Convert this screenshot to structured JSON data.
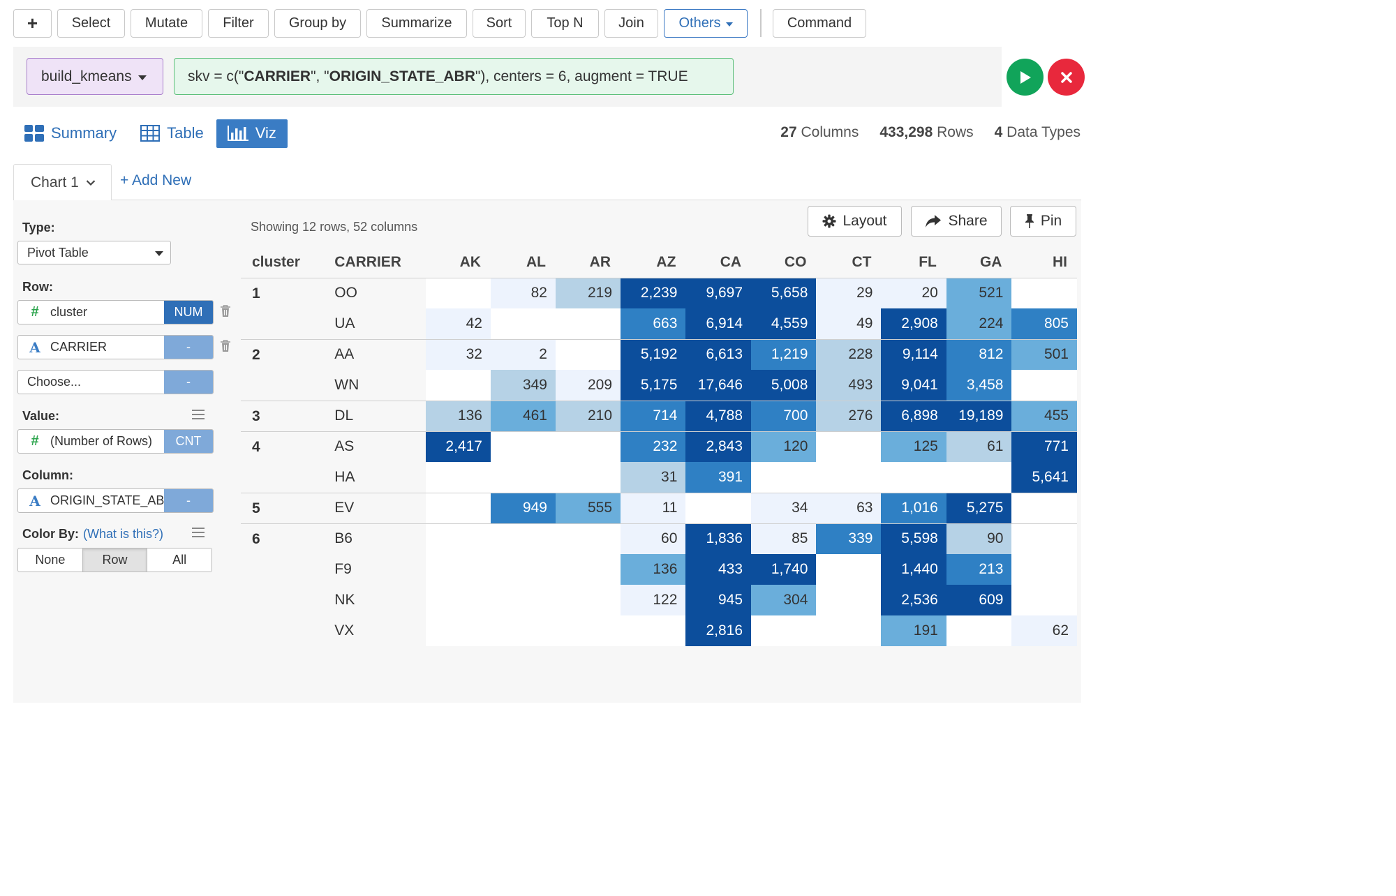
{
  "toolbar": {
    "plus_label": "+",
    "buttons": [
      "Select",
      "Mutate",
      "Filter",
      "Group by",
      "Summarize",
      "Sort",
      "Top N",
      "Join"
    ],
    "others_label": "Others",
    "command_label": "Command"
  },
  "command": {
    "function_name": "build_kmeans",
    "args_prefix": "skv = c(\"",
    "arg1": "CARRIER",
    "args_mid": "\", \"",
    "arg2": "ORIGIN_STATE_ABR",
    "args_suffix": "\"), centers = 6, augment = TRUE"
  },
  "view_tabs": {
    "summary": "Summary",
    "table": "Table",
    "viz": "Viz"
  },
  "stats": {
    "columns_count": "27",
    "columns_label": "Columns",
    "rows_count": "433,298",
    "rows_label": "Rows",
    "types_count": "4",
    "types_label": "Data Types"
  },
  "chart_tabs": {
    "current": "Chart 1",
    "add_new": "+ Add New"
  },
  "config": {
    "type_label": "Type:",
    "type_value": "Pivot Table",
    "row_label": "Row:",
    "row_fields": [
      {
        "name": "cluster",
        "type": "NUM"
      },
      {
        "name": "CARRIER",
        "type": "-"
      },
      {
        "name": "Choose...",
        "type": "-"
      }
    ],
    "value_label": "Value:",
    "value_field": {
      "name": "(Number of Rows)",
      "type": "CNT"
    },
    "column_label": "Column:",
    "column_field": {
      "name": "ORIGIN_STATE_ABR",
      "type": "-"
    },
    "color_by_label": "Color By:",
    "what_is_this": "(What is this?)",
    "color_by_options": [
      "None",
      "Row",
      "All"
    ],
    "color_by_selected": "Row"
  },
  "chart_toolbar": {
    "showing": "Showing 12 rows, 52 columns",
    "layout": "Layout",
    "share": "Share",
    "pin": "Pin"
  },
  "colors": {
    "level0": "#ffffff",
    "level1": "#edf3fd",
    "level2": "#b6d2e6",
    "level3": "#6aaedb",
    "level4": "#2f80c4",
    "level5": "#0c4e9c"
  },
  "chart_data": {
    "type": "table",
    "row_headers": [
      "cluster",
      "CARRIER"
    ],
    "columns": [
      "AK",
      "AL",
      "AR",
      "AZ",
      "CA",
      "CO",
      "CT",
      "FL",
      "GA",
      "HI"
    ],
    "rows": [
      {
        "cluster": "1",
        "carrier": "OO",
        "values": [
          "",
          "82",
          "219",
          "2,239",
          "9,697",
          "5,658",
          "29",
          "20",
          "521",
          ""
        ],
        "levels": [
          0,
          1,
          2,
          5,
          5,
          5,
          1,
          1,
          3,
          0
        ]
      },
      {
        "cluster": "",
        "carrier": "UA",
        "values": [
          "42",
          "",
          "",
          "663",
          "6,914",
          "4,559",
          "49",
          "2,908",
          "224",
          "805"
        ],
        "levels": [
          1,
          0,
          0,
          4,
          5,
          5,
          1,
          5,
          3,
          4
        ]
      },
      {
        "cluster": "2",
        "carrier": "AA",
        "values": [
          "32",
          "2",
          "",
          "5,192",
          "6,613",
          "1,219",
          "228",
          "9,114",
          "812",
          "501"
        ],
        "levels": [
          1,
          1,
          0,
          5,
          5,
          4,
          2,
          5,
          4,
          3
        ]
      },
      {
        "cluster": "",
        "carrier": "WN",
        "values": [
          "",
          "349",
          "209",
          "5,175",
          "17,646",
          "5,008",
          "493",
          "9,041",
          "3,458",
          ""
        ],
        "levels": [
          0,
          2,
          1,
          5,
          5,
          5,
          2,
          5,
          4,
          0
        ]
      },
      {
        "cluster": "3",
        "carrier": "DL",
        "values": [
          "136",
          "461",
          "210",
          "714",
          "4,788",
          "700",
          "276",
          "6,898",
          "19,189",
          "455"
        ],
        "levels": [
          2,
          3,
          2,
          4,
          5,
          4,
          2,
          5,
          5,
          3
        ]
      },
      {
        "cluster": "4",
        "carrier": "AS",
        "values": [
          "2,417",
          "",
          "",
          "232",
          "2,843",
          "120",
          "",
          "125",
          "61",
          "771"
        ],
        "levels": [
          5,
          0,
          0,
          4,
          5,
          3,
          0,
          3,
          2,
          5
        ]
      },
      {
        "cluster": "",
        "carrier": "HA",
        "values": [
          "",
          "",
          "",
          "31",
          "391",
          "",
          "",
          "",
          "",
          "5,641"
        ],
        "levels": [
          0,
          0,
          0,
          2,
          4,
          0,
          0,
          0,
          0,
          5
        ]
      },
      {
        "cluster": "5",
        "carrier": "EV",
        "values": [
          "",
          "949",
          "555",
          "11",
          "",
          "34",
          "63",
          "1,016",
          "5,275",
          ""
        ],
        "levels": [
          0,
          4,
          3,
          1,
          0,
          1,
          1,
          4,
          5,
          0
        ]
      },
      {
        "cluster": "6",
        "carrier": "B6",
        "values": [
          "",
          "",
          "",
          "60",
          "1,836",
          "85",
          "339",
          "5,598",
          "90",
          ""
        ],
        "levels": [
          0,
          0,
          0,
          1,
          5,
          1,
          4,
          5,
          2,
          0
        ]
      },
      {
        "cluster": "",
        "carrier": "F9",
        "values": [
          "",
          "",
          "",
          "136",
          "433",
          "1,740",
          "",
          "1,440",
          "213",
          ""
        ],
        "levels": [
          0,
          0,
          0,
          3,
          5,
          5,
          0,
          5,
          4,
          0
        ]
      },
      {
        "cluster": "",
        "carrier": "NK",
        "values": [
          "",
          "",
          "",
          "122",
          "945",
          "304",
          "",
          "2,536",
          "609",
          ""
        ],
        "levels": [
          0,
          0,
          0,
          1,
          5,
          3,
          0,
          5,
          5,
          0
        ]
      },
      {
        "cluster": "",
        "carrier": "VX",
        "values": [
          "",
          "",
          "",
          "",
          "2,816",
          "",
          "",
          "191",
          "",
          "62"
        ],
        "levels": [
          0,
          0,
          0,
          0,
          5,
          0,
          0,
          3,
          0,
          1
        ]
      }
    ],
    "group_starts": [
      0,
      2,
      4,
      5,
      7,
      8
    ]
  }
}
